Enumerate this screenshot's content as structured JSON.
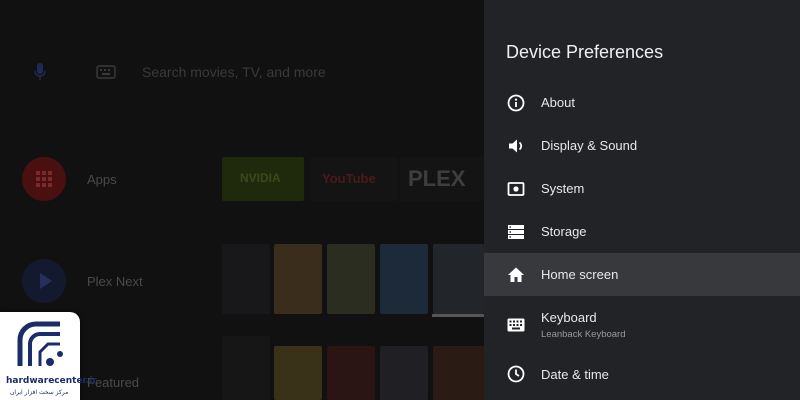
{
  "launcher": {
    "search_placeholder": "Search movies, TV, and more",
    "rows": [
      {
        "label": "Apps"
      },
      {
        "label": "Plex Next"
      },
      {
        "label": "Featured"
      }
    ],
    "app_tiles": [
      {
        "name": "NVIDIA",
        "text": "NVIDIA"
      },
      {
        "name": "YouTube",
        "text": "YouTube"
      },
      {
        "name": "Plex",
        "text": "PLEX"
      }
    ]
  },
  "logo": {
    "url": "hardwarecenter.ir",
    "subtitle": "مرکز سخت افزار ایران"
  },
  "panel": {
    "title": "Device Preferences",
    "items": [
      {
        "label": "About",
        "icon": "info-icon"
      },
      {
        "label": "Display & Sound",
        "icon": "speaker-icon"
      },
      {
        "label": "System",
        "icon": "system-icon"
      },
      {
        "label": "Storage",
        "icon": "storage-icon"
      },
      {
        "label": "Home screen",
        "icon": "home-icon",
        "selected": true
      },
      {
        "label": "Keyboard",
        "sublabel": "Leanback Keyboard",
        "icon": "keyboard-icon"
      },
      {
        "label": "Date & time",
        "icon": "clock-icon"
      }
    ]
  },
  "colors": {
    "panel_bg": "#222327",
    "selected_bg": "#38393d",
    "accent_red": "#6a1212"
  }
}
